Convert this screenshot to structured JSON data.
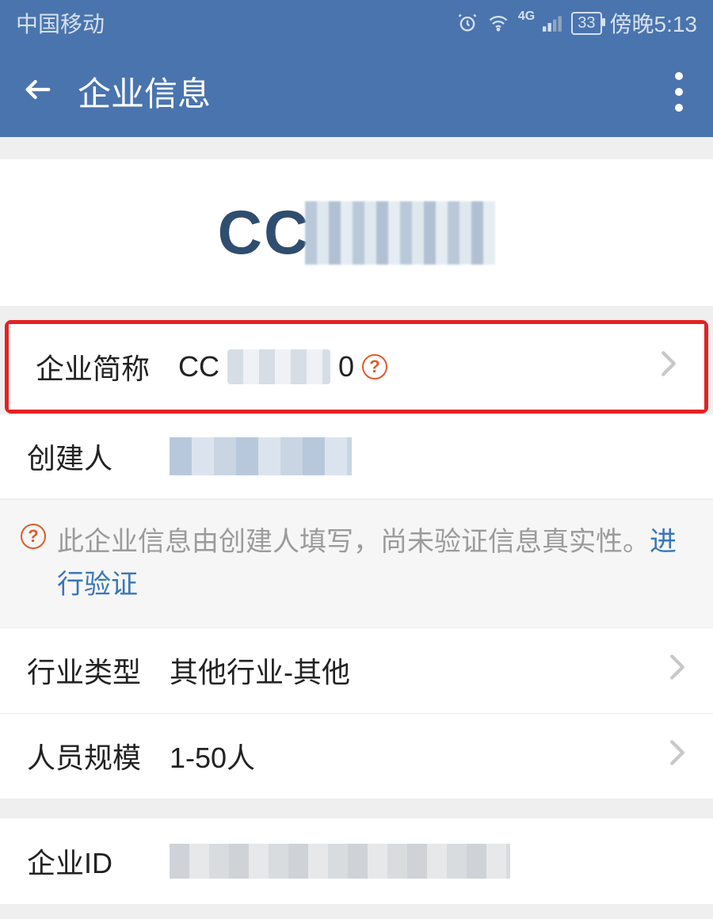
{
  "status": {
    "carrier": "中国移动",
    "battery": "33",
    "time": "傍晚5:13",
    "signal_type": "4G"
  },
  "nav": {
    "title": "企业信息"
  },
  "logo": {
    "prefix": "CC"
  },
  "rows": {
    "short_name": {
      "label": "企业简称",
      "value_prefix": "CC",
      "value_suffix": "0"
    },
    "creator": {
      "label": "创建人"
    },
    "industry": {
      "label": "行业类型",
      "value": "其他行业-其他"
    },
    "staff_size": {
      "label": "人员规模",
      "value": "1-50人"
    },
    "company_id": {
      "label": "企业ID"
    }
  },
  "notice": {
    "text": "此企业信息由创建人填写，尚未验证信息真实性。",
    "link": "进行验证"
  }
}
